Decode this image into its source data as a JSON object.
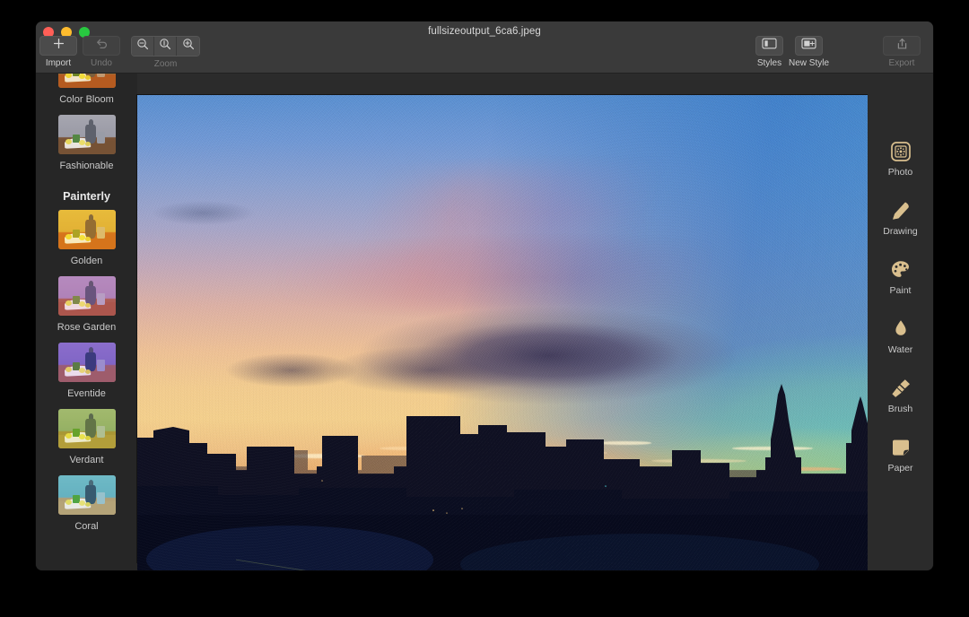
{
  "window": {
    "title": "fullsizeoutput_6ca6.jpeg",
    "traffic_lights": [
      "close",
      "minimize",
      "zoom"
    ]
  },
  "toolbar": {
    "import_label": "Import",
    "import_icon": "plus-icon",
    "undo_label": "Undo",
    "undo_icon": "undo-arrow-icon",
    "zoom_label": "Zoom",
    "zoom_out_icon": "magnifier-minus-icon",
    "zoom_fit_icon": "magnifier-one-icon",
    "zoom_in_icon": "magnifier-plus-icon",
    "styles_label": "Styles",
    "styles_icon": "sidebar-panel-icon",
    "new_style_label": "New Style",
    "new_style_icon": "new-style-icon",
    "export_label": "Export",
    "export_icon": "share-up-arrow-icon"
  },
  "sidebar": {
    "sections": [
      {
        "heading": null,
        "presets": [
          {
            "label": "Color Bloom",
            "thumb_tint": "#b98a52",
            "clipped": true
          },
          {
            "label": "Fashionable",
            "thumb_tint": "#8d8d93"
          }
        ]
      },
      {
        "heading": "Painterly",
        "presets": [
          {
            "label": "Golden",
            "thumb_tint": "#c99b4e"
          },
          {
            "label": "Rose Garden",
            "thumb_tint": "#9a7d9c"
          },
          {
            "label": "Eventide",
            "thumb_tint": "#7d6fa8"
          },
          {
            "label": "Verdant",
            "thumb_tint": "#8a9a6a"
          },
          {
            "label": "Coral",
            "thumb_tint": "#6f9ba6"
          }
        ]
      }
    ]
  },
  "tools": [
    {
      "label": "Photo",
      "icon": "photo-icon"
    },
    {
      "label": "Drawing",
      "icon": "pencil-icon"
    },
    {
      "label": "Paint",
      "icon": "palette-icon"
    },
    {
      "label": "Water",
      "icon": "water-drop-icon"
    },
    {
      "label": "Brush",
      "icon": "brush-icon"
    },
    {
      "label": "Paper",
      "icon": "paper-icon"
    }
  ],
  "colors": {
    "window_chrome": "#3a3a3a",
    "sidebar_bg": "#262626",
    "canvas_bg": "#2b2b2b",
    "tool_icon": "#d9bf8e",
    "text_primary": "#d8d8d8",
    "text_dim": "#787878"
  },
  "artwork": {
    "description": "Watercolor painting of a city skyline silhouette at sunset",
    "sky_colors": [
      "#5a8fd0",
      "#a6a5c7",
      "#dcb0a4",
      "#f3cf8c",
      "#e2a86d"
    ],
    "accent_teal": "#60c4ba",
    "accent_green": "#a8cb76",
    "silhouette": "#0d1226"
  }
}
